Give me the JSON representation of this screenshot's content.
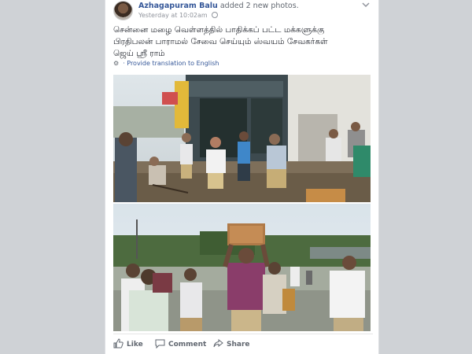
{
  "post": {
    "author": "Azhagapuram Balu",
    "action_text": "added 2 new photos.",
    "timestamp": "Yesterday at 10:02am",
    "privacy_icon": "globe-icon",
    "menu_icon": "chevron-down-icon",
    "text_line1": "சென்னை மழை வெள்ளத்தில் பாதிக்கப் பட்ட மக்களுக்கு",
    "text_line2": "பிரதிபலன் பாராமல் சேவை செய்யும் ஸ்வயம் சேவகர்கள்",
    "text_line3": "ஜெய் ஸ்ரீ ராம்",
    "translate_label": "· Provide translation to English"
  },
  "actions": {
    "like": "Like",
    "comment": "Comment",
    "share": "Share"
  },
  "colors": {
    "link": "#365899",
    "meta": "#90949c",
    "background": "#d7d9dc"
  }
}
